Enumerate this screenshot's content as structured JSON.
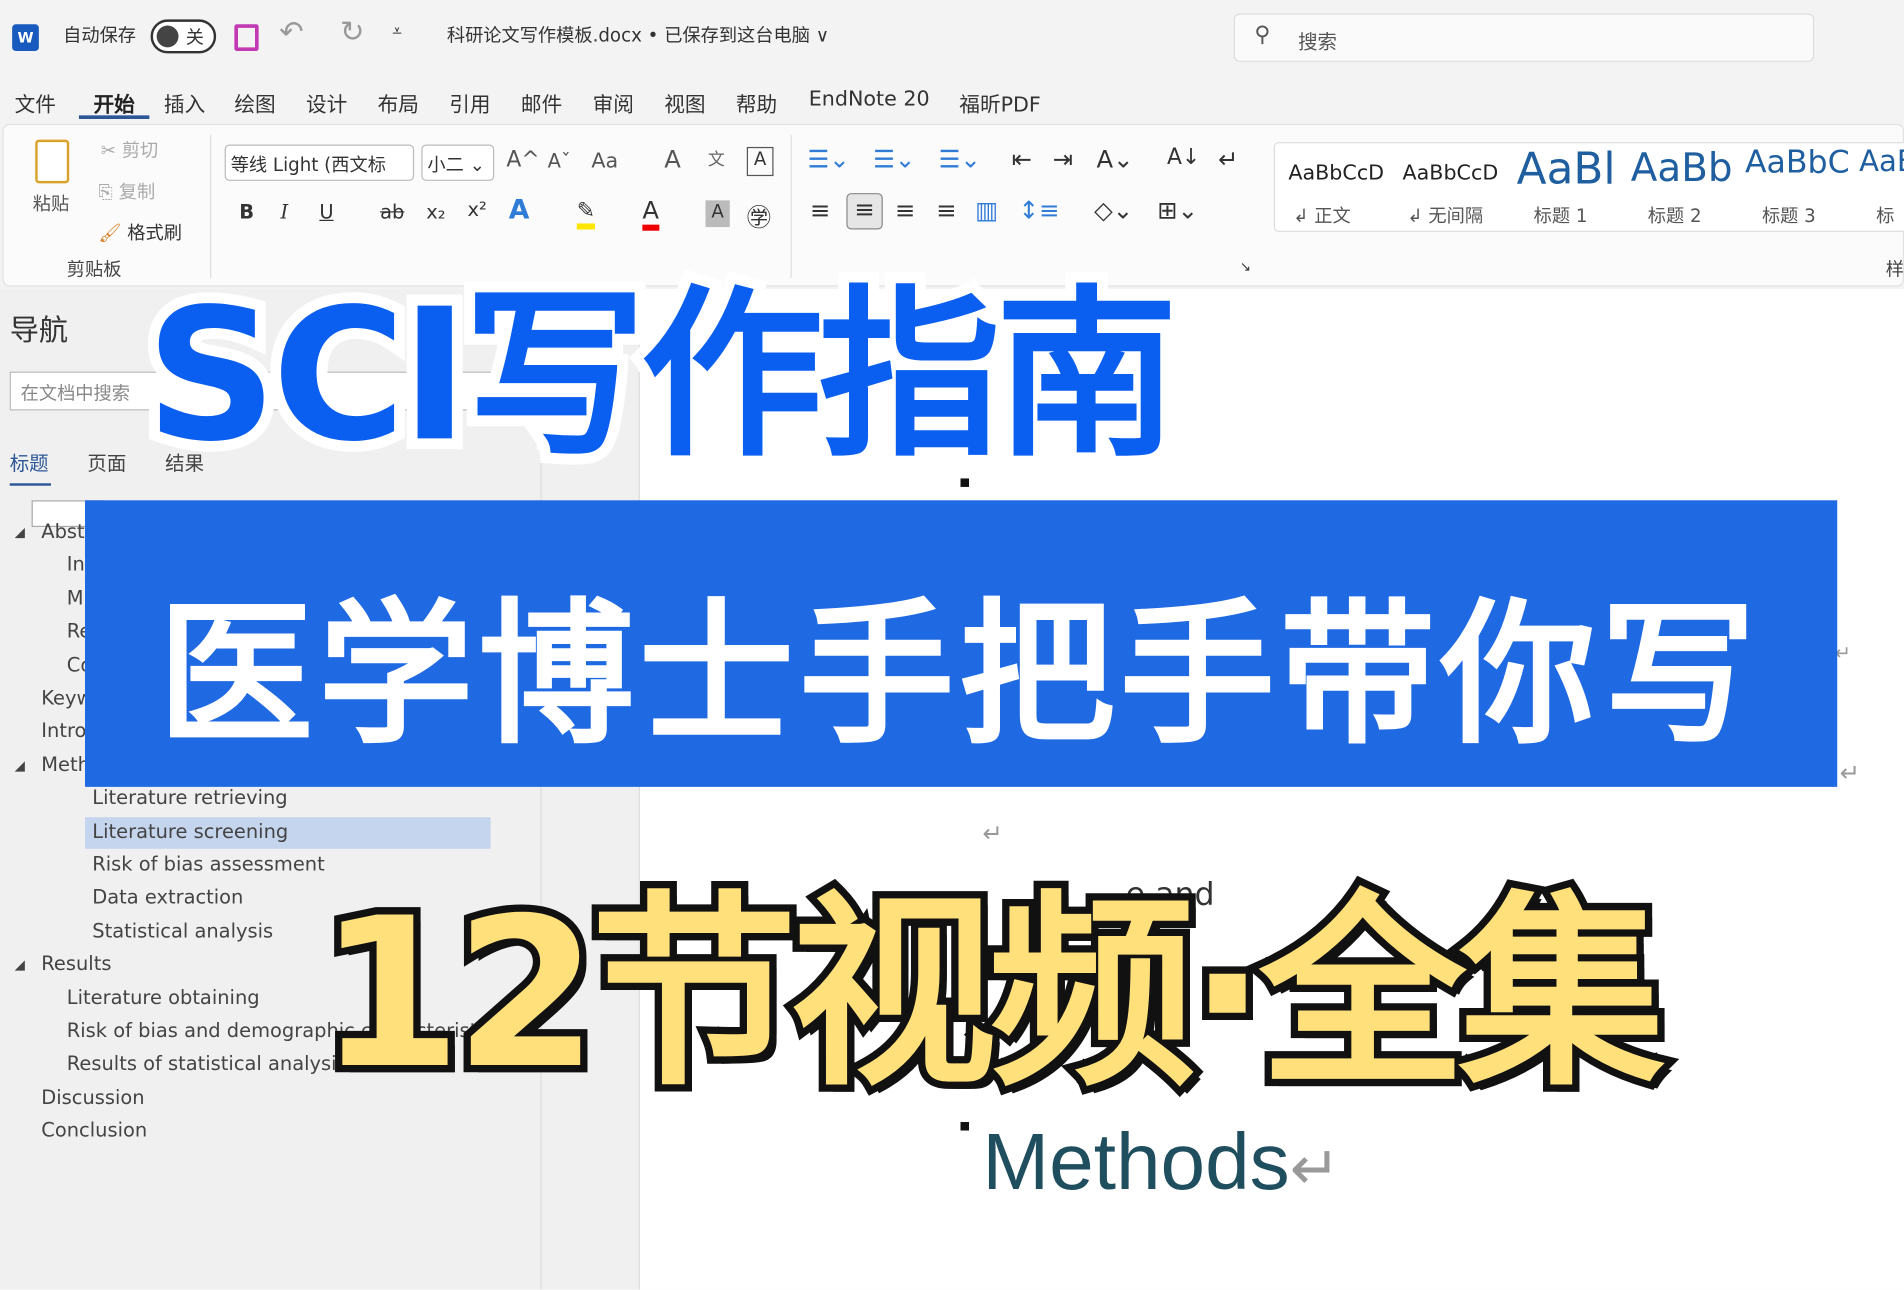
{
  "titlebar": {
    "app_icon": "word-icon",
    "autosave_label": "自动保存",
    "autosave_state": "关",
    "save_icon": "save-icon",
    "undo_icon": "undo-icon",
    "redo_icon": "redo-icon",
    "customize_icon": "customize-icon",
    "document_title": "科研论文写作模板.docx • 已保存到这台电脑 ∨",
    "search_placeholder": "搜索"
  },
  "menu": [
    "文件",
    "开始",
    "插入",
    "绘图",
    "设计",
    "布局",
    "引用",
    "邮件",
    "审阅",
    "视图",
    "帮助",
    "EndNote 20",
    "福昕PDF"
  ],
  "ribbon": {
    "clipboard": {
      "paste": "粘贴",
      "cut": "剪切",
      "copy": "复制",
      "format_painter": "格式刷",
      "group": "剪贴板"
    },
    "font": {
      "name": "等线 Light (西文标",
      "size": "小二",
      "bold": "B",
      "italic": "I",
      "underline": "U",
      "strike": "ab",
      "sub": "x₂",
      "sup": "x²",
      "grow": "A^",
      "shrink": "Aˇ",
      "case": "Aa"
    },
    "styles": [
      {
        "preview": "AaBbCcD",
        "label": "↲ 正文"
      },
      {
        "preview": "AaBbCcD",
        "label": "↲ 无间隔"
      },
      {
        "preview": "AaBl",
        "label": "标题 1"
      },
      {
        "preview": "AaBb",
        "label": "标题 2"
      },
      {
        "preview": "AaBbC",
        "label": "标题 3"
      },
      {
        "preview": "AaB",
        "label": "标"
      }
    ],
    "styles_group": "样"
  },
  "nav": {
    "title": "导航",
    "search_placeholder": "在文档中搜索",
    "tabs": [
      "标题",
      "页面",
      "结果"
    ],
    "tree": [
      {
        "label": "Abst",
        "level": 0,
        "expanded": true
      },
      {
        "label": "In",
        "level": 1
      },
      {
        "label": "M",
        "level": 1
      },
      {
        "label": "Re",
        "level": 1
      },
      {
        "label": "Co",
        "level": 1
      },
      {
        "label": "Keyw",
        "level": 0
      },
      {
        "label": "Intro",
        "level": 0
      },
      {
        "label": "Meth",
        "level": 0,
        "expanded": true
      },
      {
        "label": "Literature retrieving",
        "level": 2
      },
      {
        "label": "Literature screening",
        "level": 2,
        "selected": true
      },
      {
        "label": "Risk of bias assessment",
        "level": 2
      },
      {
        "label": "Data extraction",
        "level": 2
      },
      {
        "label": "Statistical analysis",
        "level": 2
      },
      {
        "label": "Results",
        "level": 0,
        "expanded": true
      },
      {
        "label": "Literature obtaining",
        "level": 1
      },
      {
        "label": "Risk of bias and demographic characteristi...",
        "level": 1
      },
      {
        "label": "Results of statistical analysis",
        "level": 1
      },
      {
        "label": "Discussion",
        "level": 0
      },
      {
        "label": "Conclusion",
        "level": 0
      }
    ]
  },
  "document": {
    "partial_text": "e and",
    "heading": "Methods"
  },
  "overlay": {
    "title": "SCI写作指南",
    "banner": "医学博士手把手带你写",
    "subtitle": "12节视频·全集"
  },
  "colors": {
    "accent": "#0a5ff0",
    "banner": "#1f69e3",
    "yellow": "#ffe07a",
    "heading": "#1f4e5f",
    "selected": "#c5d5ee"
  }
}
